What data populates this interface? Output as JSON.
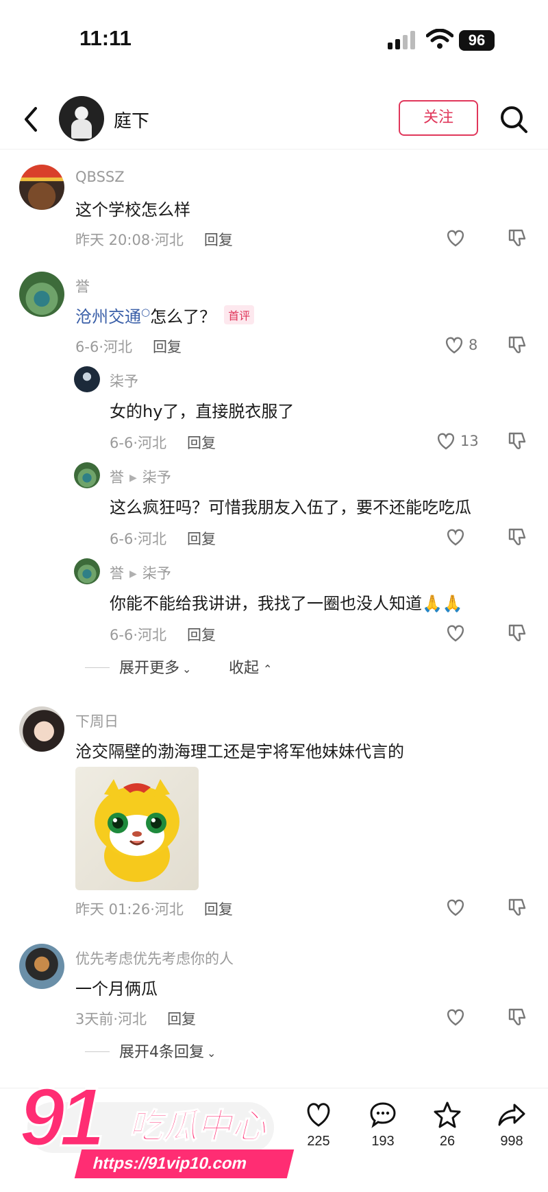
{
  "status_bar": {
    "time": "11:11",
    "battery": "96"
  },
  "header": {
    "username": "庭下",
    "follow_label": "关注"
  },
  "comments": [
    {
      "user": "QBSSZ",
      "text": "这个学校怎么样",
      "time": "昨天 20:08",
      "location": "河北",
      "reply_label": "回复",
      "likes": ""
    },
    {
      "user": "誉",
      "mention": "沧州交通",
      "text": "怎么了？",
      "badge": "首评",
      "time": "6-6",
      "location": "河北",
      "reply_label": "回复",
      "likes": "8",
      "replies": [
        {
          "user": "柒予",
          "text": "女的hy了，直接脱衣服了",
          "time": "6-6",
          "location": "河北",
          "reply_label": "回复",
          "likes": "13"
        },
        {
          "user": "誉",
          "reply_to": "柒予",
          "text": "这么疯狂吗？可惜我朋友入伍了，要不还能吃吃瓜",
          "time": "6-6",
          "location": "河北",
          "reply_label": "回复",
          "likes": ""
        },
        {
          "user": "誉",
          "reply_to": "柒予",
          "text": "你能不能给我讲讲，我找了一圈也没人知道🙏🙏",
          "time": "6-6",
          "location": "河北",
          "reply_label": "回复",
          "likes": ""
        }
      ],
      "expand_more": "展开更多",
      "collapse": "收起"
    },
    {
      "user": "下周日",
      "text": "沧交隔壁的渤海理工还是宇将军他妹妹代言的",
      "time": "昨天 01:26",
      "location": "河北",
      "reply_label": "回复",
      "likes": ""
    },
    {
      "user": "优先考虑优先考虑你的人",
      "text": "一个月俩瓜",
      "time": "3天前",
      "location": "河北",
      "reply_label": "回复",
      "likes": "",
      "expand_replies": "展开4条回复"
    }
  ],
  "bottom_bar": {
    "likes": "225",
    "comments": "193",
    "favorites": "26",
    "shares": "998"
  },
  "watermark": {
    "brand_number": "91",
    "brand_title": "吃瓜中心",
    "url": "https://91vip10.com"
  },
  "colors": {
    "accent": "#e0365a",
    "mention": "#3a5fa8",
    "watermark": "#ff2d73"
  }
}
